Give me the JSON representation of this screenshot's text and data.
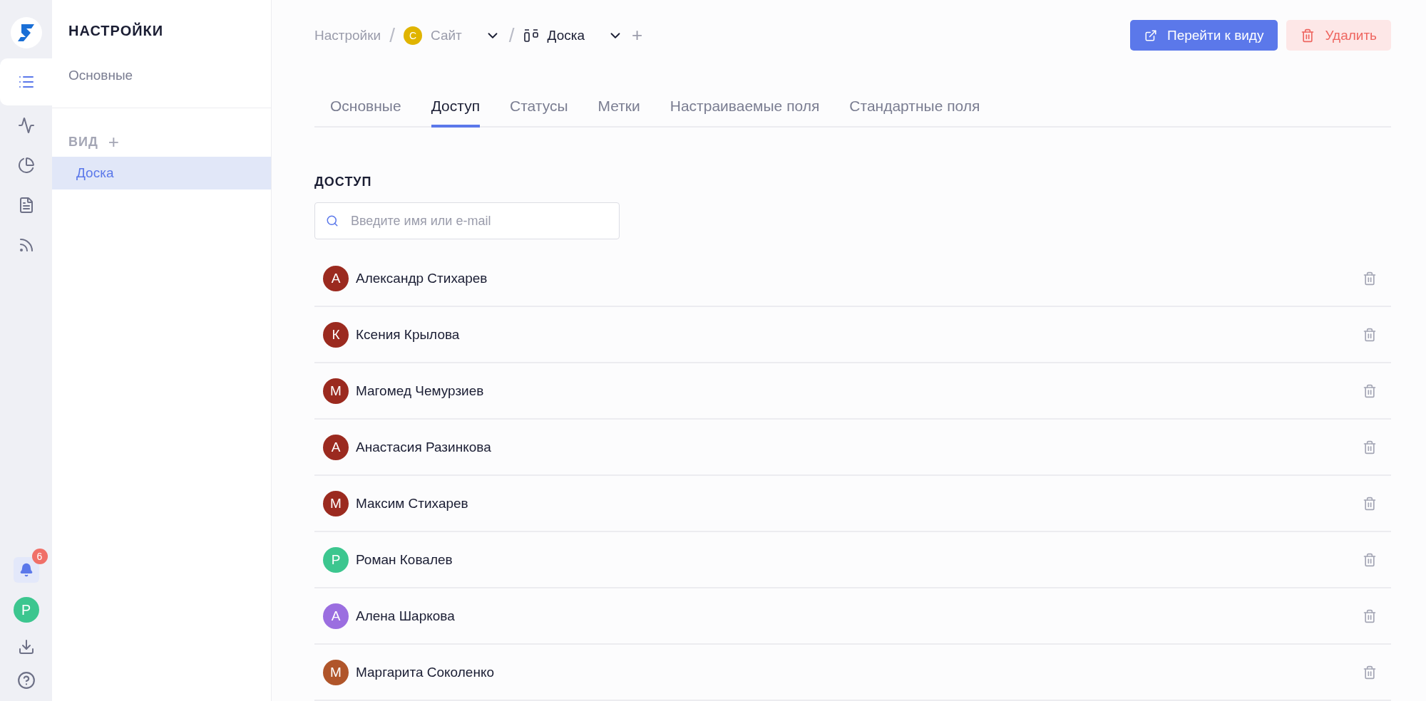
{
  "rail": {
    "items": [
      {
        "kind": "list",
        "selected": true
      },
      {
        "kind": "activity",
        "selected": false
      },
      {
        "kind": "pie",
        "selected": false
      },
      {
        "kind": "document",
        "selected": false
      },
      {
        "kind": "feed",
        "selected": false
      }
    ],
    "notifications": {
      "count": "6",
      "selected": true
    },
    "user": {
      "initial": "Р",
      "color": "#3cc68f"
    }
  },
  "sidebar": {
    "title": "НАСТРОЙКИ",
    "items": [
      {
        "label": "Основные",
        "selected": false
      }
    ],
    "section": {
      "title": "ВИД",
      "add": "+",
      "items": [
        {
          "label": "Доска",
          "selected": true
        }
      ]
    }
  },
  "breadcrumbs": {
    "root": "Настройки",
    "separator": "/",
    "project": {
      "initial": "С",
      "label": "Сайт",
      "color": "#e0b400"
    },
    "view": {
      "label": "Доска"
    },
    "add": "+"
  },
  "actions": [
    {
      "kind": "primary",
      "label": "Перейти к виду"
    },
    {
      "kind": "danger",
      "label": "Удалить"
    }
  ],
  "tabs": [
    {
      "label": "Основные",
      "selected": false
    },
    {
      "label": "Доступ",
      "selected": true
    },
    {
      "label": "Статусы",
      "selected": false
    },
    {
      "label": "Метки",
      "selected": false
    },
    {
      "label": "Настраиваемые поля",
      "selected": false
    },
    {
      "label": "Стандартные поля",
      "selected": false
    }
  ],
  "access": {
    "title": "ДОСТУП",
    "search": {
      "placeholder": "Введите имя или e-mail"
    },
    "members": [
      {
        "initial": "А",
        "name": "Александр Стихарев",
        "color": "#9b2a1f"
      },
      {
        "initial": "К",
        "name": "Ксения Крылова",
        "color": "#9b2a1f"
      },
      {
        "initial": "М",
        "name": "Магомед Чемурзиев",
        "color": "#9b2a1f"
      },
      {
        "initial": "А",
        "name": "Анастасия Разинкова",
        "color": "#9b2a1f"
      },
      {
        "initial": "М",
        "name": "Максим Стихарев",
        "color": "#9b2a1f"
      },
      {
        "initial": "Р",
        "name": "Роман Ковалев",
        "color": "#3cc68f"
      },
      {
        "initial": "А",
        "name": "Алена Шаркова",
        "color": "#9b6ee0"
      },
      {
        "initial": "М",
        "name": "Маргарита Соколенко",
        "color": "#b0552a"
      }
    ]
  }
}
